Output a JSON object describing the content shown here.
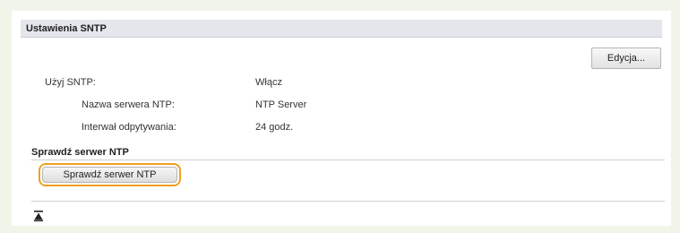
{
  "section": {
    "title": "Ustawienia SNTP"
  },
  "toolbar": {
    "edit_label": "Edycja..."
  },
  "settings": {
    "use_sntp": {
      "label": "Użyj SNTP:",
      "value": "Włącz"
    },
    "server_name": {
      "label": "Nazwa serwera NTP:",
      "value": "NTP Server"
    },
    "polling_interval": {
      "label": "Interwał odpytywania:",
      "value": "24 godz."
    }
  },
  "check": {
    "section_title": "Sprawdź serwer NTP",
    "button_label": "Sprawdź serwer NTP"
  },
  "icons": {
    "back_to_top": "arrow-top-icon"
  },
  "colors": {
    "page_bg": "#f1f4e8",
    "header_bg": "#e4e6ec",
    "highlight": "#f0a020"
  }
}
